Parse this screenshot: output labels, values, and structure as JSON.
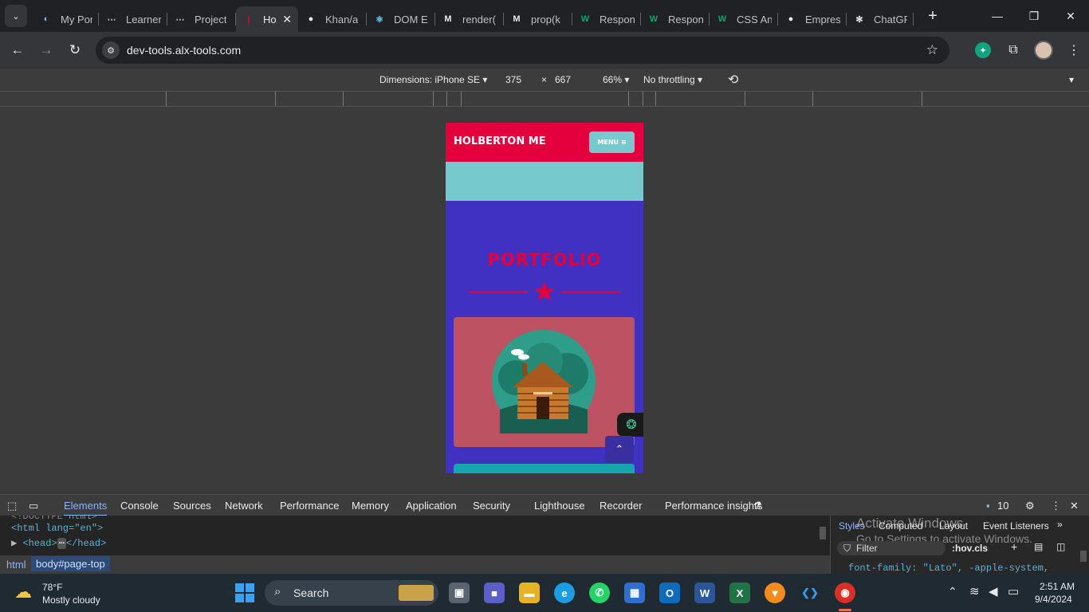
{
  "browser": {
    "tabs": [
      {
        "label": "My Por",
        "icon": "globe-icon"
      },
      {
        "label": "Learner",
        "icon": "alx-icon"
      },
      {
        "label": "Project",
        "icon": "alx-icon"
      },
      {
        "label": "Ho",
        "icon": "holberton-icon",
        "active": true
      },
      {
        "label": "Khan/a",
        "icon": "github-icon"
      },
      {
        "label": "DOM E",
        "icon": "react-icon"
      },
      {
        "label": "render(",
        "icon": "mdn-icon"
      },
      {
        "label": "prop(k",
        "icon": "mdn-icon"
      },
      {
        "label": "Respon",
        "icon": "w3schools-icon"
      },
      {
        "label": "Respon",
        "icon": "w3schools-icon"
      },
      {
        "label": "CSS An",
        "icon": "w3schools-icon"
      },
      {
        "label": "Empres",
        "icon": "github-icon"
      },
      {
        "label": "ChatGP",
        "icon": "openai-icon"
      }
    ],
    "url": "dev-tools.alx-tools.com"
  },
  "device_toolbar": {
    "dimensions_label": "Dimensions: iPhone SE",
    "width": "375",
    "times": "×",
    "height": "667",
    "zoom": "66%",
    "throttling": "No throttling"
  },
  "mobile_page": {
    "brand": "HOLBERTON ME",
    "menu_label": "MENU ≡",
    "heading": "PORTFOLIO",
    "accent_color": "#e3003d",
    "card_color": "#bd5262",
    "background_color": "#4131c2",
    "teal_color": "#76c9cc"
  },
  "devtools": {
    "tabs": [
      "Elements",
      "Console",
      "Sources",
      "Network",
      "Performance",
      "Memory",
      "Application",
      "Security",
      "Lighthouse",
      "Recorder",
      "Performance insights"
    ],
    "active_tab": "Elements",
    "issue_count": "10",
    "elements": {
      "line1": "<!DOCTYPE html>",
      "html_open": "<html lang=\"en\">",
      "head_line": "<head>",
      "head_ellipsis": "⋯",
      "head_close": "</head>"
    },
    "breadcrumb": [
      "html",
      "body#page-top"
    ],
    "styles_tabs": [
      "Styles",
      "Computed",
      "Layout",
      "Event Listeners"
    ],
    "filter_placeholder": "Filter",
    "hov": ":hov",
    "cls": ".cls",
    "css_line": "font-family: \"Lato\", -apple-system,",
    "watermark_line1": "Activate Windows",
    "watermark_line2": "Go to Settings to activate Windows."
  },
  "taskbar": {
    "weather_temp": "78°F",
    "weather_desc": "Mostly cloudy",
    "search_label": "Search",
    "time": "2:51 AM",
    "date": "9/4/2024"
  }
}
